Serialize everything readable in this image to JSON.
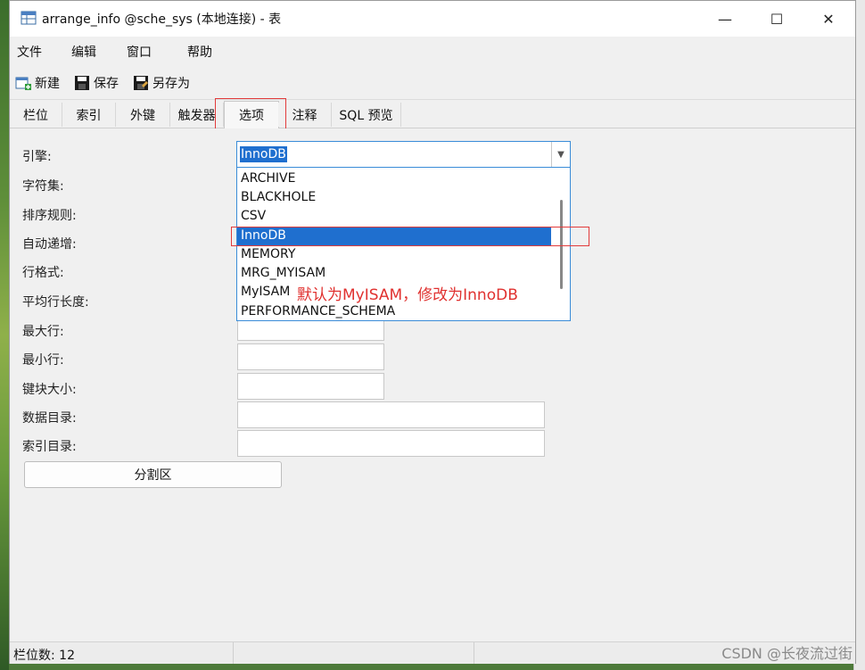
{
  "window": {
    "title": "arrange_info @sche_sys (本地连接) - 表"
  },
  "controls": {
    "minimize": "—",
    "maximize": "☐",
    "close": "✕"
  },
  "menu": [
    "文件",
    "编辑",
    "窗口",
    "帮助"
  ],
  "toolbar": {
    "new": "新建",
    "save": "保存",
    "save_as": "另存为"
  },
  "tabs": [
    "栏位",
    "索引",
    "外键",
    "触发器",
    "选项",
    "注释",
    "SQL 预览"
  ],
  "active_tab": "选项",
  "form": {
    "labels": [
      "引擎:",
      "字符集:",
      "排序规则:",
      "自动递增:",
      "行格式:",
      "平均行长度:",
      "最大行:",
      "最小行:",
      "键块大小:",
      "数据目录:",
      "索引目录:"
    ],
    "engine_value": "InnoDB",
    "partition_button": "分割区"
  },
  "engine_options": [
    "ARCHIVE",
    "BLACKHOLE",
    "CSV",
    "InnoDB",
    "MEMORY",
    "MRG_MYISAM",
    "MyISAM",
    "PERFORMANCE_SCHEMA"
  ],
  "selected_option": "InnoDB",
  "annotation": "默认为MyISAM，修改为InnoDB",
  "status": {
    "field_count": "栏位数: 12"
  },
  "watermark": "CSDN @长夜流过街",
  "colors": {
    "selection": "#1f6fcf",
    "annotation": "#e0312f",
    "focus_border": "#3a8cd8"
  }
}
